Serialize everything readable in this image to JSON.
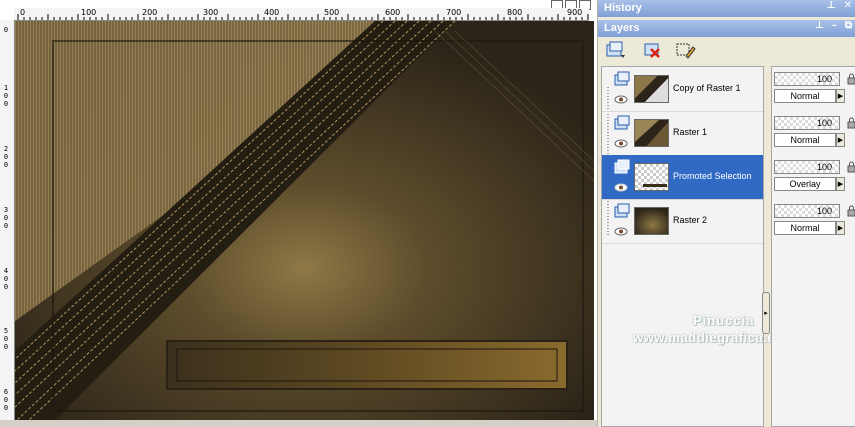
{
  "rulers": {
    "top": [
      "0",
      "100",
      "200",
      "300",
      "400",
      "500",
      "600",
      "700",
      "800",
      "900"
    ],
    "left": [
      "0",
      "1\n0\n0",
      "2\n0\n0",
      "3\n0\n0",
      "4\n0\n0",
      "5\n0\n0",
      "6\n0\n0"
    ]
  },
  "panels": {
    "history": {
      "title": "History"
    },
    "layers": {
      "title": "Layers",
      "tools": [
        "new-raster-layer-icon",
        "delete-layer-icon",
        "edit-selection-icon"
      ],
      "items": [
        {
          "name": "Copy of Raster 1",
          "opacity": "100",
          "blend": "Normal",
          "selected": false
        },
        {
          "name": "Raster 1",
          "opacity": "100",
          "blend": "Normal",
          "selected": false
        },
        {
          "name": "Promoted Selection",
          "opacity": "100",
          "blend": "Overlay",
          "selected": true
        },
        {
          "name": "Raster 2",
          "opacity": "100",
          "blend": "Normal",
          "selected": false
        }
      ]
    }
  },
  "watermark": {
    "line1": "Pinuccia",
    "line2": "www.maddiegrafica.eu"
  },
  "colors": {
    "selection": "#316ac5",
    "title_bar": "#7f9fd6",
    "canvas_base": "#5b4a2c"
  }
}
